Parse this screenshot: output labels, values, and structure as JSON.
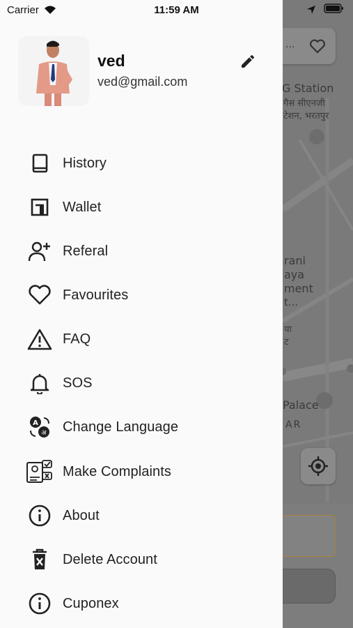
{
  "status_bar": {
    "carrier": "Carrier",
    "time": "11:59 AM"
  },
  "profile": {
    "name": "ved",
    "email": "ved@gmail.com"
  },
  "menu": [
    {
      "label": "History",
      "icon": "book-icon"
    },
    {
      "label": "Wallet",
      "icon": "wallet-icon"
    },
    {
      "label": "Referal",
      "icon": "person-add-icon"
    },
    {
      "label": "Favourites",
      "icon": "heart-icon"
    },
    {
      "label": "FAQ",
      "icon": "warning-icon"
    },
    {
      "label": "SOS",
      "icon": "bell-icon"
    },
    {
      "label": "Change Language",
      "icon": "translate-icon"
    },
    {
      "label": "Make Complaints",
      "icon": "complaint-icon"
    },
    {
      "label": "About",
      "icon": "info-icon"
    },
    {
      "label": "Delete Account",
      "icon": "trash-icon"
    },
    {
      "label": "Cuponex",
      "icon": "info-icon"
    }
  ],
  "map": {
    "labels": [
      "...",
      "G Station",
      "गैस सीएनजी",
      "टेशन, भरतपुर",
      "rani",
      "aya",
      "ment",
      "t...",
      "या",
      "ट",
      "Palace",
      "AR"
    ]
  }
}
